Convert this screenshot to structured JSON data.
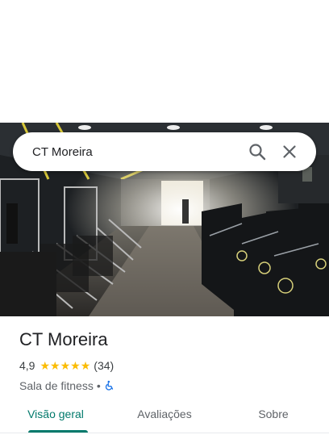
{
  "search": {
    "query": "CT Moreira",
    "search_icon": "search-icon",
    "close_icon": "close-icon"
  },
  "photo": {
    "description_icon": "gym-photo"
  },
  "place": {
    "name": "CT Moreira",
    "rating": "4,9",
    "stars": 5,
    "review_count": "(34)",
    "category": "Sala de fitness",
    "separator": "•",
    "accessibility_icon": "wheelchair-icon"
  },
  "tabs": [
    {
      "label": "Visão geral",
      "active": true
    },
    {
      "label": "Avaliações",
      "active": false
    },
    {
      "label": "Sobre",
      "active": false
    }
  ],
  "colors": {
    "accent": "#00796b",
    "star": "#fbbc04",
    "text": "#202124",
    "secondary": "#5f6368",
    "wheelchair": "#1a73e8"
  }
}
